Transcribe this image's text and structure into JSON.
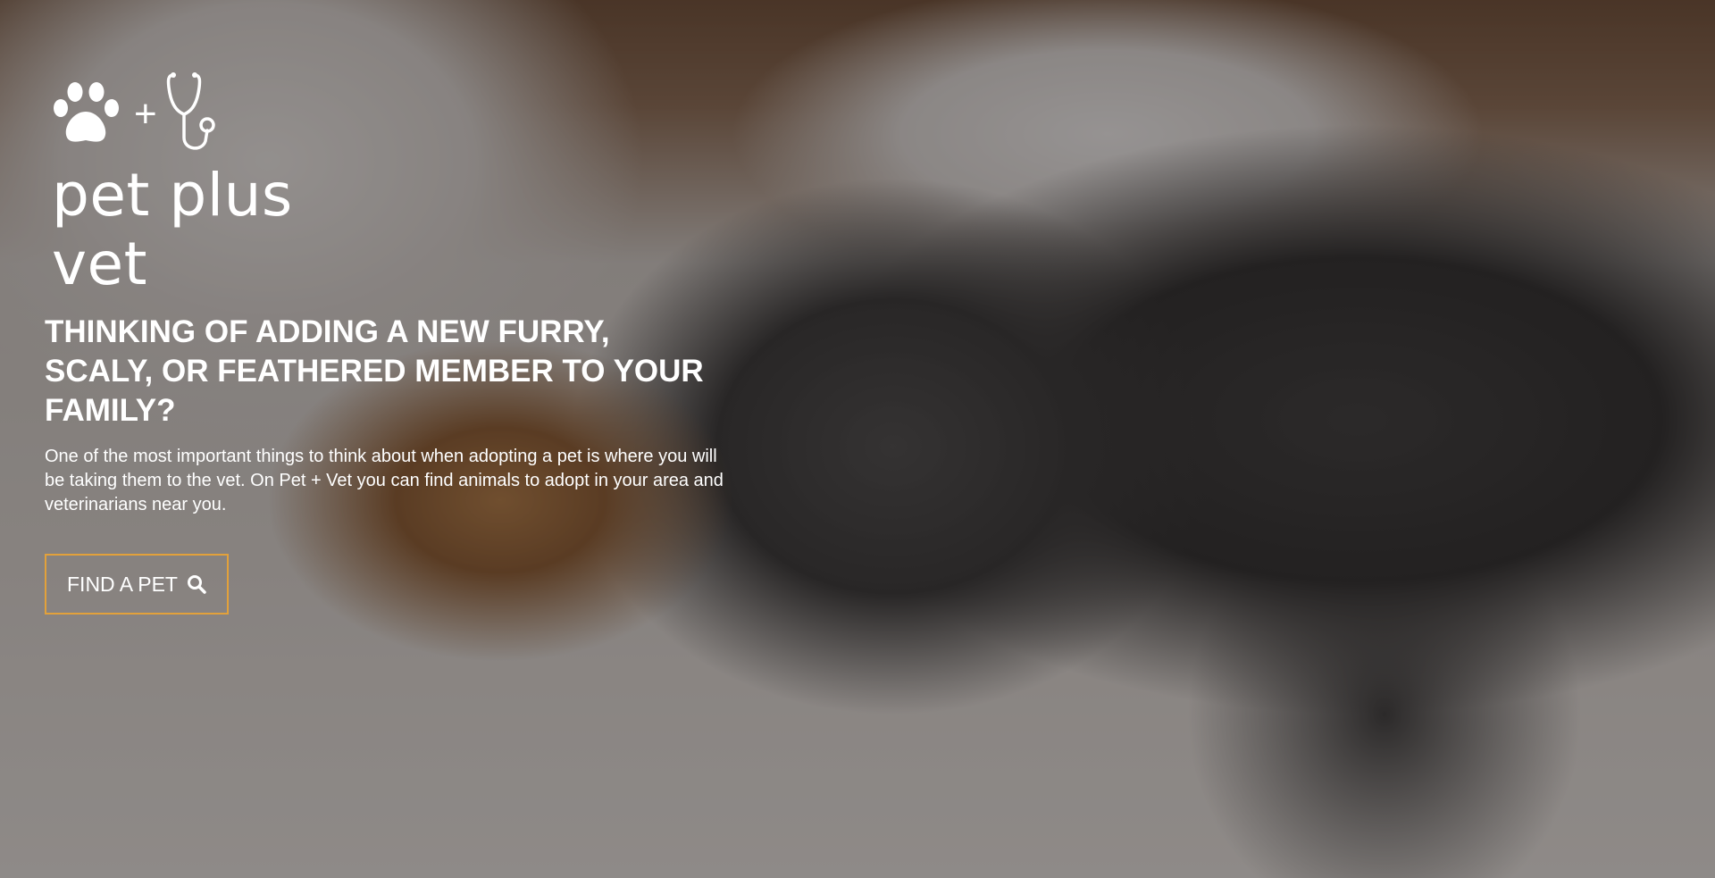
{
  "brand": {
    "plus_symbol": "+",
    "name": "pet plus vet",
    "icons": [
      "paw-icon",
      "stethoscope-icon"
    ]
  },
  "hero": {
    "headline": "THINKING OF ADDING A NEW FURRY, SCALY, OR FEATHERED MEMBER TO YOUR FAMILY?",
    "description": "One of the most important things to think about when adopting a pet is where you will be taking them to the vet. On Pet + Vet you can find animals to adopt in your area and veterinarians near you.",
    "cta_label": "FIND A PET",
    "cta_icon": "search-icon"
  },
  "colors": {
    "text": "#ffffff",
    "button_border": "#e2a13b"
  }
}
